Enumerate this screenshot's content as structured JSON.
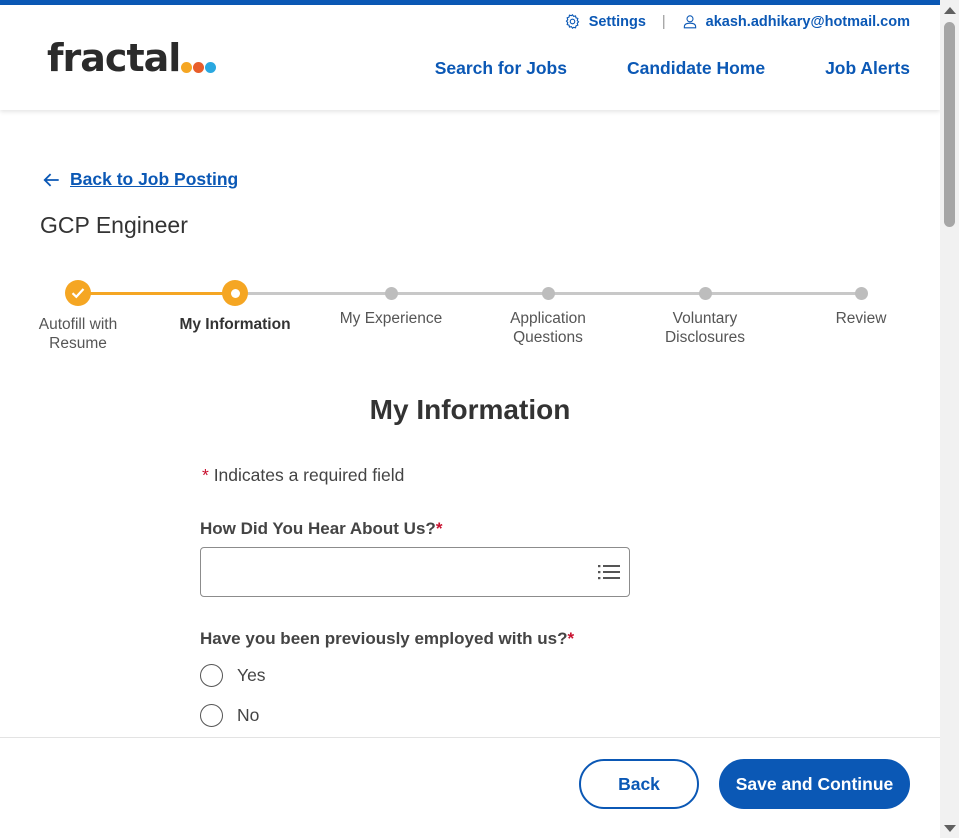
{
  "brand": {
    "logo_text": "fractal",
    "logo_dot_colors": [
      "#f5a623",
      "#e85d2a",
      "#2aa8e0"
    ],
    "accent_color": "#0b58b5",
    "progress_color": "#f5a623",
    "required_color": "#c8102e"
  },
  "header": {
    "settings_label": "Settings",
    "settings_icon": "gear-icon",
    "user_email": "akash.adhikary@hotmail.com",
    "user_icon": "person-icon",
    "nav": {
      "search_jobs": "Search for Jobs",
      "candidate_home": "Candidate Home",
      "job_alerts": "Job Alerts"
    }
  },
  "back_link": "Back to Job Posting",
  "job_title": "GCP Engineer",
  "steps": [
    {
      "label_line1": "Autofill with",
      "label_line2": "Resume",
      "state": "done"
    },
    {
      "label_line1": "My Information",
      "label_line2": "",
      "state": "current"
    },
    {
      "label_line1": "My Experience",
      "label_line2": "",
      "state": "todo"
    },
    {
      "label_line1": "Application",
      "label_line2": "Questions",
      "state": "todo"
    },
    {
      "label_line1": "Voluntary",
      "label_line2": "Disclosures",
      "state": "todo"
    },
    {
      "label_line1": "Review",
      "label_line2": "",
      "state": "todo"
    }
  ],
  "form": {
    "section_title": "My Information",
    "required_star": "*",
    "required_note": "Indicates a required field",
    "q_hear_about": {
      "label": "How Did You Hear About Us?",
      "value": ""
    },
    "q_prev_employed": {
      "label": "Have you been previously employed with us?",
      "options": [
        "Yes",
        "No"
      ],
      "selected": null
    }
  },
  "footer": {
    "back_label": "Back",
    "save_label": "Save and Continue"
  }
}
